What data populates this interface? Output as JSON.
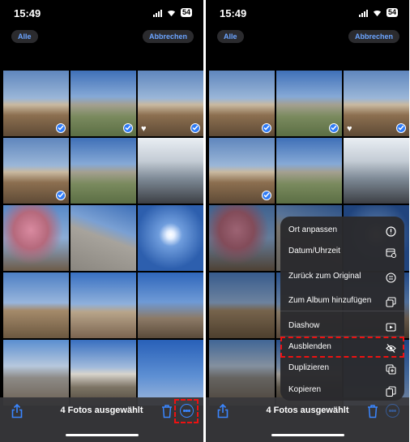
{
  "screens": [
    {
      "time": "15:49",
      "battery": "54",
      "select_all_label": "Alle",
      "cancel_label": "Abbrechen",
      "selection_count": "4 Fotos ausgewählt",
      "photos": [
        {
          "scene": "hill-village",
          "selected": true,
          "favorite": false
        },
        {
          "scene": "valley-village",
          "selected": true,
          "favorite": false
        },
        {
          "scene": "hill-village",
          "selected": true,
          "favorite": true
        },
        {
          "scene": "hill-village",
          "selected": true,
          "favorite": false
        },
        {
          "scene": "valley-village",
          "selected": false,
          "favorite": false
        },
        {
          "scene": "people-smoke",
          "selected": false,
          "favorite": false
        },
        {
          "scene": "pink-blossoms",
          "selected": false,
          "favorite": false
        },
        {
          "scene": "rock-sky",
          "selected": false,
          "favorite": false
        },
        {
          "scene": "sun-sky",
          "selected": false,
          "favorite": false
        },
        {
          "scene": "valley-flags",
          "selected": false,
          "favorite": false
        },
        {
          "scene": "mountains",
          "selected": false,
          "favorite": false
        },
        {
          "scene": "prayer-flags",
          "selected": false,
          "favorite": false
        },
        {
          "scene": "flag-mountains",
          "selected": false,
          "favorite": false
        },
        {
          "scene": "mountain-valley",
          "selected": false,
          "favorite": false
        },
        {
          "scene": "sky-clouds",
          "selected": false,
          "favorite": false
        }
      ]
    },
    {
      "time": "15:49",
      "battery": "54",
      "select_all_label": "Alle",
      "cancel_label": "Abbrechen",
      "selection_count": "4 Fotos ausgewählt",
      "photos": [
        {
          "scene": "hill-village",
          "selected": true,
          "favorite": false
        },
        {
          "scene": "valley-village",
          "selected": true,
          "favorite": false
        },
        {
          "scene": "hill-village",
          "selected": true,
          "favorite": true
        },
        {
          "scene": "hill-village",
          "selected": true,
          "favorite": false
        },
        {
          "scene": "valley-village",
          "selected": false,
          "favorite": false
        },
        {
          "scene": "people-smoke",
          "selected": false,
          "favorite": false
        },
        {
          "scene": "pink-blossoms",
          "selected": false,
          "favorite": false
        },
        {
          "scene": "rock-sky",
          "selected": false,
          "favorite": false
        },
        {
          "scene": "sun-sky",
          "selected": false,
          "favorite": false
        },
        {
          "scene": "valley-flags",
          "selected": false,
          "favorite": false
        },
        {
          "scene": "mountains",
          "selected": false,
          "favorite": false
        },
        {
          "scene": "prayer-flags",
          "selected": false,
          "favorite": false
        },
        {
          "scene": "flag-mountains",
          "selected": false,
          "favorite": false
        },
        {
          "scene": "mountain-valley",
          "selected": false,
          "favorite": false
        },
        {
          "scene": "sky-clouds",
          "selected": false,
          "favorite": false
        }
      ],
      "menu": [
        {
          "label": "Ort anpassen",
          "icon": "location-info-icon"
        },
        {
          "label": "Datum/Uhrzeit",
          "icon": "calendar-clock-icon"
        },
        {
          "label": "Zurück zum Original",
          "icon": "revert-icon"
        },
        {
          "label": "Zum Album hinzufügen",
          "icon": "add-to-album-icon"
        },
        {
          "label": "Diashow",
          "icon": "play-icon"
        },
        {
          "label": "Ausblenden",
          "icon": "eye-slash-icon",
          "highlighted": true
        },
        {
          "label": "Duplizieren",
          "icon": "duplicate-icon"
        },
        {
          "label": "Kopieren",
          "icon": "copy-icon"
        }
      ]
    }
  ],
  "colors": {
    "accent": "#3a86ff",
    "highlight": "#e11111",
    "check": "#2f7bf6"
  }
}
